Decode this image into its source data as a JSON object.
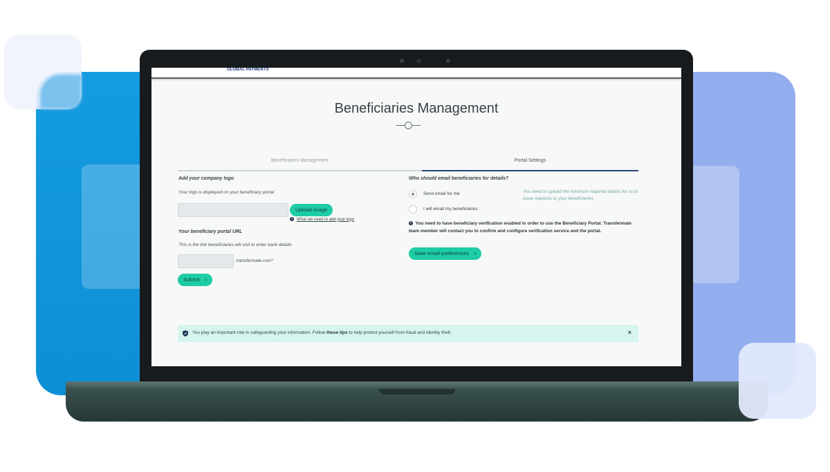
{
  "brand": {
    "name": "GLOBAL PAYMENTS"
  },
  "page": {
    "title": "Beneficiaries Management"
  },
  "tabs": [
    {
      "label": "Beneficiaries Management",
      "active": false
    },
    {
      "label": "Portal Settings",
      "active": true
    }
  ],
  "logo_section": {
    "heading": "Add your company logo",
    "description": "Your logo is displayed on your beneficiary portal",
    "upload_button": "Upload image",
    "help_link": "What we need to add your logo"
  },
  "url_section": {
    "heading": "Your beneficiary portal URL",
    "description": "This is the link beneficiaries will visit to enter bank details",
    "domain_suffix": ".transfermate.com*",
    "submit_button": "Submit"
  },
  "email_section": {
    "heading": "Who should email beneficiaries for details?",
    "options": [
      {
        "label": "Send email for me",
        "selected": true
      },
      {
        "label": "I will email my beneficiaries",
        "selected": false
      }
    ],
    "hint": "You need to upload the minimum required details for us to issue requests to your beneficiaries",
    "notice": "You need to have beneficiary verification enabled in order to use the Beneficiary Portal. Transfermate team member will contact you to confirm and configure verification service and the portal.",
    "save_button": "Save email preferences"
  },
  "security_banner": {
    "text_before": "You play an important role in safeguarding your information. Follow ",
    "link_text": "these tips",
    "text_after": " to help protect yourself from fraud and identity theft.",
    "close": "×"
  },
  "colors": {
    "accent": "#1ecca6",
    "tab_active": "#26407a",
    "banner_bg": "#d5f5ee",
    "bg_blue": "#159ce0",
    "bg_periwinkle": "#93aeee"
  },
  "icons": {
    "info": "info-icon",
    "shield": "shield-icon",
    "close": "close-icon",
    "chevron": "chevron-right-icon"
  }
}
